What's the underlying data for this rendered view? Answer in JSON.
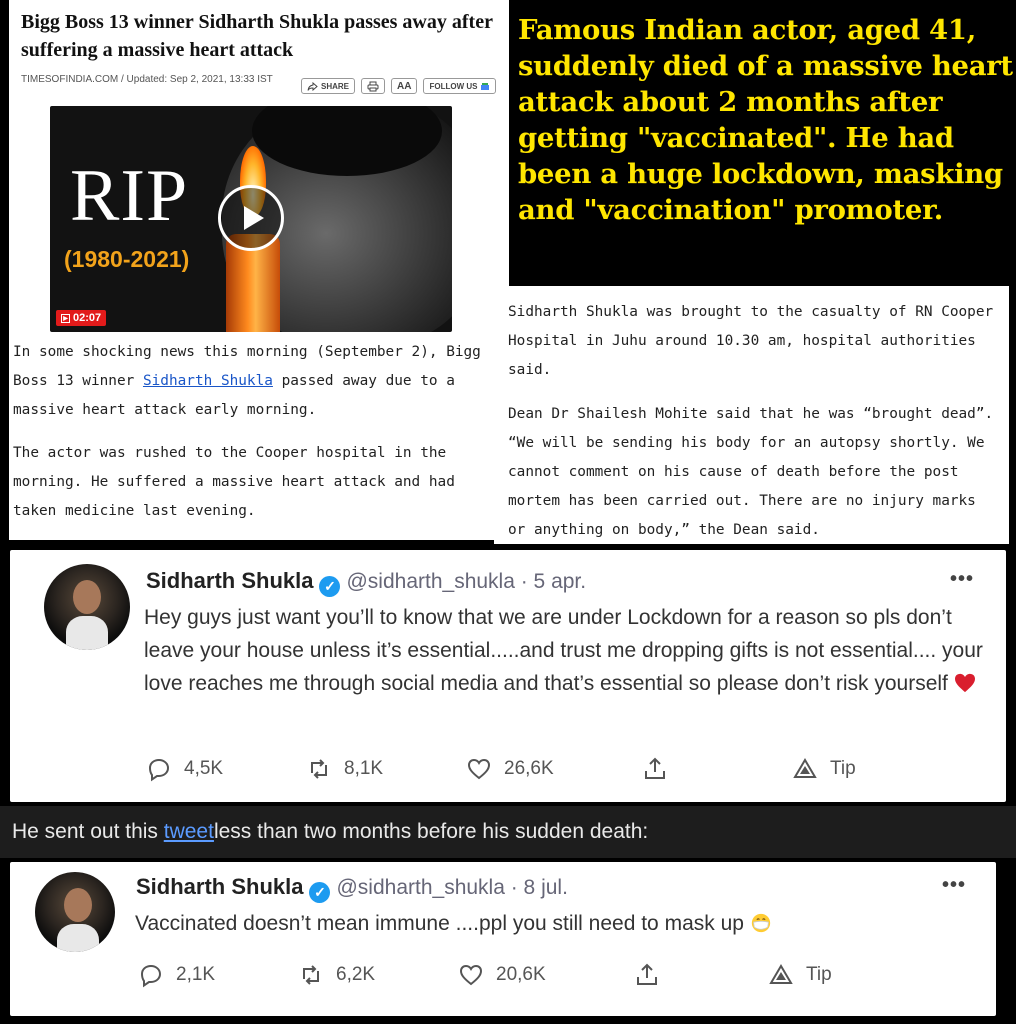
{
  "article": {
    "headline": "Bigg Boss 13 winner Sidharth Shukla passes away after suffering a massive heart attack",
    "meta": "TIMESOFINDIA.COM / Updated: Sep 2, 2021, 13:33 IST",
    "tools": {
      "share": "SHARE",
      "print": "",
      "font_size": "AA",
      "follow": "FOLLOW US"
    },
    "video": {
      "rip": "RIP",
      "years": "(1980-2021)",
      "duration": "02:07"
    },
    "para1_before": "In some shocking news this morning (September 2), Bigg Boss 13 winner ",
    "para1_link": "Sidharth Shukla",
    "para1_after": " passed away due to a massive heart attack early morning.",
    "para2": "The actor was rushed to the Cooper hospital in the morning. He suffered a massive heart attack and had taken medicine last evening."
  },
  "claim": {
    "text": "Famous Indian actor, aged 41, suddenly died of a massive heart attack about 2 months after  getting \"vaccinated\". He had been a huge lockdown, masking and \"vaccination\" promoter."
  },
  "article2": {
    "para1": "Sidharth Shukla was brought to the casualty of RN Cooper Hospital in Juhu around 10.30 am, hospital authorities said.",
    "para2": "Dean Dr Shailesh Mohite said that he was “brought dead”. “We will be sending his body for an autopsy shortly. We cannot comment on his cause of death before the post mortem has been carried out. There are no injury marks or anything on body,” the Dean said."
  },
  "tweet1": {
    "name": "Sidharth Shukla",
    "handle": "@sidharth_shukla · 5 apr.",
    "more": "•••",
    "text": "Hey guys just want you’ll to know that we are under Lockdown for a reason so pls don’t leave your house unless it’s essential.....and trust me dropping gifts is not essential.... your love reaches me through social media and that’s essential so please don’t risk yourself",
    "emoji": "red-heart",
    "replies": "4,5K",
    "retweets": "8,1K",
    "likes": "26,6K",
    "tip": "Tip"
  },
  "caption": {
    "before": "He sent out this ",
    "link": "tweet",
    "after": "less than two months before his sudden death:"
  },
  "tweet2": {
    "name": "Sidharth Shukla",
    "handle": "@sidharth_shukla · 8 jul.",
    "more": "•••",
    "text": "Vaccinated doesn’t mean immune ....ppl you still need to mask up",
    "emoji": "face-with-medical-mask",
    "replies": "2,1K",
    "retweets": "6,2K",
    "likes": "20,6K",
    "tip": "Tip"
  },
  "colors": {
    "claim_text": "#ffe600",
    "link": "#1a56c8",
    "caption_link": "#5b9bff",
    "verified": "#1d9bf0",
    "duration_badge": "#e21b1b"
  }
}
